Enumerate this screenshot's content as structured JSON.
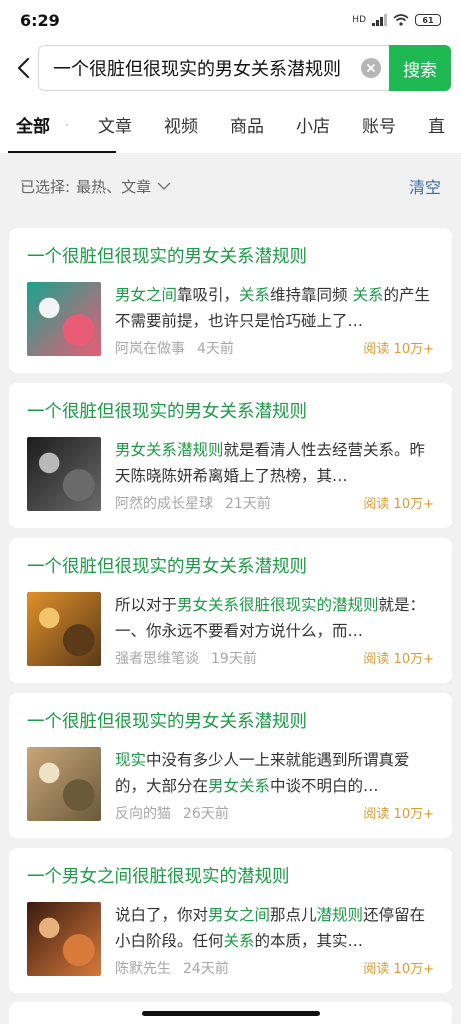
{
  "status": {
    "time": "6:29",
    "network": "HD",
    "battery": "61"
  },
  "search": {
    "query": "一个很脏但很现实的男女关系潜规则",
    "button": "搜索"
  },
  "tabs": [
    "全部",
    "文章",
    "视频",
    "商品",
    "小店",
    "账号",
    "直"
  ],
  "filter": {
    "prefix": "已选择:",
    "value": "最热、文章",
    "clear": "清空"
  },
  "results": [
    {
      "title": "一个很脏但很现实的男女关系潜规则",
      "segments": [
        {
          "t": "男女之间",
          "hl": true
        },
        {
          "t": "靠吸引，",
          "hl": false
        },
        {
          "t": "关系",
          "hl": true
        },
        {
          "t": "维持靠同频 ",
          "hl": false
        },
        {
          "t": "关系",
          "hl": true
        },
        {
          "t": "的产生不需要前提，也许只是恰巧碰上了…",
          "hl": false
        }
      ],
      "author": "阿岚在做事",
      "time": "4天前",
      "reads": "阅读 10万+",
      "thumb": [
        "#1aa38f",
        "#e85d75",
        "#f4f4f4"
      ]
    },
    {
      "title": "一个很脏但很现实的男女关系潜规则",
      "segments": [
        {
          "t": "男女关系潜规则",
          "hl": true
        },
        {
          "t": "就是看清人性去经营关系。昨天陈晓陈妍希离婚上了热榜，其…",
          "hl": false
        }
      ],
      "author": "阿然的成长星球",
      "time": "21天前",
      "reads": "阅读 10万+",
      "thumb": [
        "#1c1c1c",
        "#6a6a6a",
        "#b9b9b9"
      ]
    },
    {
      "title": "一个很脏但很现实的男女关系潜规则",
      "segments": [
        {
          "t": "所以对于",
          "hl": false
        },
        {
          "t": "男女关系很脏很现实的潜规则",
          "hl": true
        },
        {
          "t": "就是：一、你永远不要看对方说什么，而…",
          "hl": false
        }
      ],
      "author": "强者思维笔谈",
      "time": "19天前",
      "reads": "阅读 10万+",
      "thumb": [
        "#e0902a",
        "#5a3a18",
        "#f3c56b"
      ]
    },
    {
      "title": "一个很脏但很现实的男女关系潜规则",
      "segments": [
        {
          "t": "现实",
          "hl": true
        },
        {
          "t": "中没有多少人一上来就能遇到所谓真爱的，大部分在",
          "hl": false
        },
        {
          "t": "男女关系",
          "hl": true
        },
        {
          "t": "中谈不明白的…",
          "hl": false
        }
      ],
      "author": "反向的猫",
      "time": "26天前",
      "reads": "阅读 10万+",
      "thumb": [
        "#c9a67a",
        "#6b5a3a",
        "#efe2c4"
      ]
    },
    {
      "title": "一个男女之间很脏很现实的潜规则",
      "segments": [
        {
          "t": "说白了，你对",
          "hl": false
        },
        {
          "t": "男女之间",
          "hl": true
        },
        {
          "t": "那点儿",
          "hl": false
        },
        {
          "t": "潜规则",
          "hl": true
        },
        {
          "t": "还停留在小白阶段。任何",
          "hl": false
        },
        {
          "t": "关系",
          "hl": true
        },
        {
          "t": "的本质，其实…",
          "hl": false
        }
      ],
      "author": "陈默先生",
      "time": "24天前",
      "reads": "阅读 10万+",
      "thumb": [
        "#3a1b10",
        "#d77a3a",
        "#e8b07a"
      ]
    }
  ]
}
